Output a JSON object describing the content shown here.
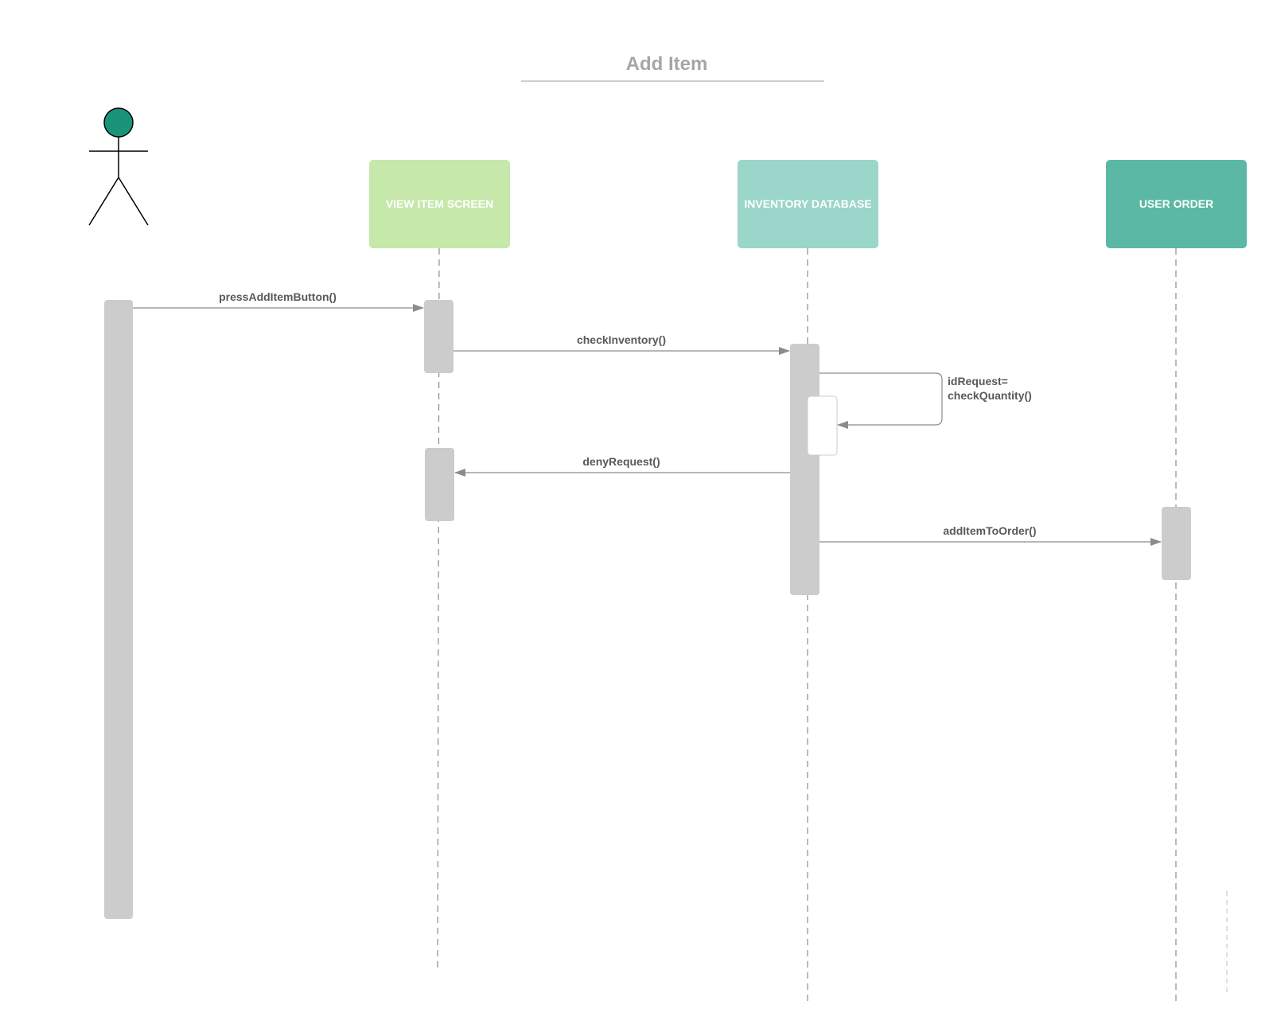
{
  "title": "Add Item",
  "actor": {
    "icon": "stick-figure-icon",
    "head_color": "#1a9479"
  },
  "participants": [
    {
      "id": "view",
      "label": "VIEW ITEM SCREEN",
      "color": "#c6e8aa"
    },
    {
      "id": "db",
      "label": "INVENTORY DATABASE",
      "color": "#9ad6ca"
    },
    {
      "id": "order",
      "label": "USER ORDER",
      "color": "#5bb8a4"
    }
  ],
  "messages": [
    {
      "label": "pressAddItemButton()",
      "from": "actor",
      "to": "view"
    },
    {
      "label": "checkInventory()",
      "from": "view",
      "to": "db"
    },
    {
      "label_lines": [
        "idRequest=",
        "checkQuantity()"
      ],
      "from": "db",
      "to": "db"
    },
    {
      "label": "denyRequest()",
      "from": "db",
      "to": "view"
    },
    {
      "label": "addItemToOrder()",
      "from": "db",
      "to": "order"
    }
  ],
  "colors": {
    "activation": "#cccccc",
    "lifeline": "#8c8c8c",
    "arrow": "#8c8c8c",
    "title_underline": "#9e9e9e"
  }
}
